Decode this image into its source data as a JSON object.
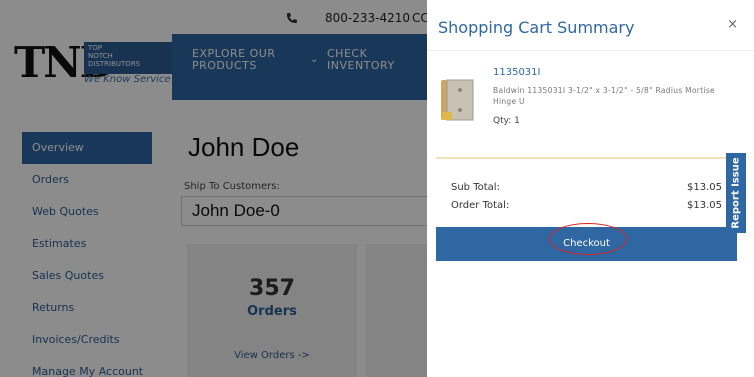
{
  "topbar": {
    "phone": "800-233-4210",
    "more": "CC"
  },
  "logo": {
    "main": "TND",
    "badge_lines": [
      "TOP",
      "NOTCH",
      "DISTRIBUTORS"
    ],
    "tagline": "We Know Service"
  },
  "nav": {
    "explore_line1": "EXPLORE OUR",
    "explore_line2": "PRODUCTS",
    "check_line1": "CHECK",
    "check_line2": "INVENTORY"
  },
  "sidebar": {
    "items": [
      {
        "label": "Overview"
      },
      {
        "label": "Orders"
      },
      {
        "label": "Web Quotes"
      },
      {
        "label": "Estimates"
      },
      {
        "label": "Sales Quotes"
      },
      {
        "label": "Returns"
      },
      {
        "label": "Invoices/Credits"
      },
      {
        "label": "Manage My Account"
      }
    ]
  },
  "main": {
    "customer_name": "John Doe",
    "ship_label": "Ship To Customers:",
    "ship_value": "John Doe-0",
    "orders_count": "357",
    "orders_label": "Orders",
    "view_orders": "View Orders ->"
  },
  "cart": {
    "title": "Shopping Cart Summary",
    "close": "×",
    "item": {
      "sku": "1135031I",
      "description": "Baldwin 1135031I 3-1/2\" x 3-1/2\" - 5/8\" Radius Mortise Hinge U",
      "qty": "Qty: 1"
    },
    "sub_total_label": "Sub Total:",
    "sub_total_value": "$13.05",
    "order_total_label": "Order Total:",
    "order_total_value": "$13.05",
    "checkout_label": "Checkout"
  },
  "report_issue": "Report Issue",
  "colors": {
    "brand_blue": "#2f67a3",
    "annotation_red": "#d22222"
  }
}
